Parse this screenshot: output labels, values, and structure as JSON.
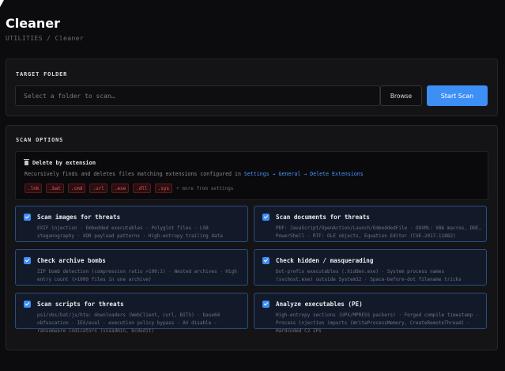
{
  "app": {
    "title": "Cleaner",
    "breadcrumb": "UTILITIES / Cleaner"
  },
  "target": {
    "section_label": "TARGET FOLDER",
    "placeholder": "Select a folder to scan…",
    "browse_label": "Browse",
    "start_label": "Start Scan"
  },
  "scan_options": {
    "section_label": "SCAN OPTIONS",
    "delete": {
      "title": "Delete by extension",
      "desc_prefix": "Recursively finds and deletes files matching extensions configured in ",
      "desc_link": "Settings → General → Delete Extensions",
      "extensions": [
        ".lnk",
        ".bat",
        ".cmd",
        ".url",
        ".exe",
        ".dll",
        ".sys"
      ],
      "more": "+ more from settings"
    },
    "cards": [
      {
        "title": "Scan images for threats",
        "desc": "EXIF injection · Embedded executables · Polyglot files · LSB steganography · XOR payload patterns · High-entropy trailing data",
        "checked": true
      },
      {
        "title": "Scan documents for threats",
        "desc": "PDF: JavaScript/OpenAction/Launch/EmbeddedFile · OOXML: VBA macros, DDE, PowerShell · RTF: OLE objects, Equation Editor (CVE-2017-11882)",
        "checked": true
      },
      {
        "title": "Check archive bombs",
        "desc": "ZIP bomb detection (compression ratio >100:1) · Nested archives · High entry count (>1000 files in one archive)",
        "checked": true
      },
      {
        "title": "Check hidden / masquerading",
        "desc": "Dot-prefix executables (.hidden.exe) · System process names (svchost.exe) outside System32 · Space-before-dot filename tricks",
        "checked": true
      },
      {
        "title": "Scan scripts for threats",
        "desc": "ps1/vbs/bat/js/hta: downloaders (WebClient, curl, BITS) · base64 obfuscation · IEX/eval · execution policy bypass · AV disable · ransomware indicators (vssadmin, bcdedit)",
        "checked": true
      },
      {
        "title": "Analyze executables (PE)",
        "desc": "High-entropy sections (UPX/MPRESS packers) · Forged compile timestamp · Process injection imports (WriteProcessMemory, CreateRemoteThread) · Hardcoded C2 IPs",
        "checked": true
      }
    ]
  },
  "colors": {
    "accent": "#3d8ff5",
    "background": "#0c0c0e",
    "danger": "#f05a5a"
  },
  "icons": {
    "cursor": "mouse-pointer-icon",
    "delete": "trash-icon",
    "checkbox": "checkbox-checked-icon"
  }
}
